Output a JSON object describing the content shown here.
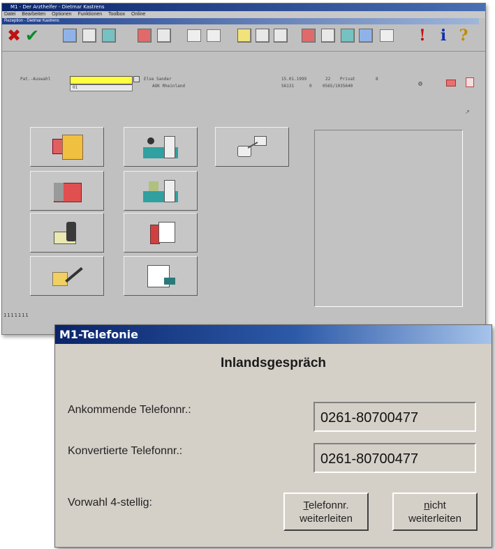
{
  "bg_window": {
    "title": "M1 - Der Arzthelfer - Dietmar Kastrens",
    "menu": [
      "Datei",
      "Bearbeiten",
      "Optionen",
      "Funktionen",
      "Toolbox",
      "Online"
    ],
    "subtitle": "Rezeption - Dietmar Kastrens",
    "info": {
      "field_label": "Pat.-Auswahl",
      "field_sub": "01",
      "patient_name": "Else Sander",
      "insurance": "AOK Rheinland",
      "date": "15.01.1999",
      "code1": "22",
      "status": "Privat",
      "code2": "8",
      "zip": "56131",
      "code3": "0",
      "phone": "0565/1035640"
    },
    "status_text": "1111111"
  },
  "dialog": {
    "title": "M1-Telefonie",
    "heading": "Inlandsgespräch",
    "rows": [
      {
        "label": "Ankommende Telefonnr.:",
        "value": "0261-80700477"
      },
      {
        "label": "Konvertierte Telefonnr.:",
        "value": "0261-80700477"
      }
    ],
    "vorwahl_label": "Vorwahl 4-stellig:",
    "btn_forward": {
      "mnemonic": "T",
      "line1_rest": "elefonnr.",
      "line2": "weiterleiten"
    },
    "btn_noforward": {
      "mnemonic": "n",
      "line1_rest": "icht",
      "line2": "weiterleiten"
    }
  }
}
